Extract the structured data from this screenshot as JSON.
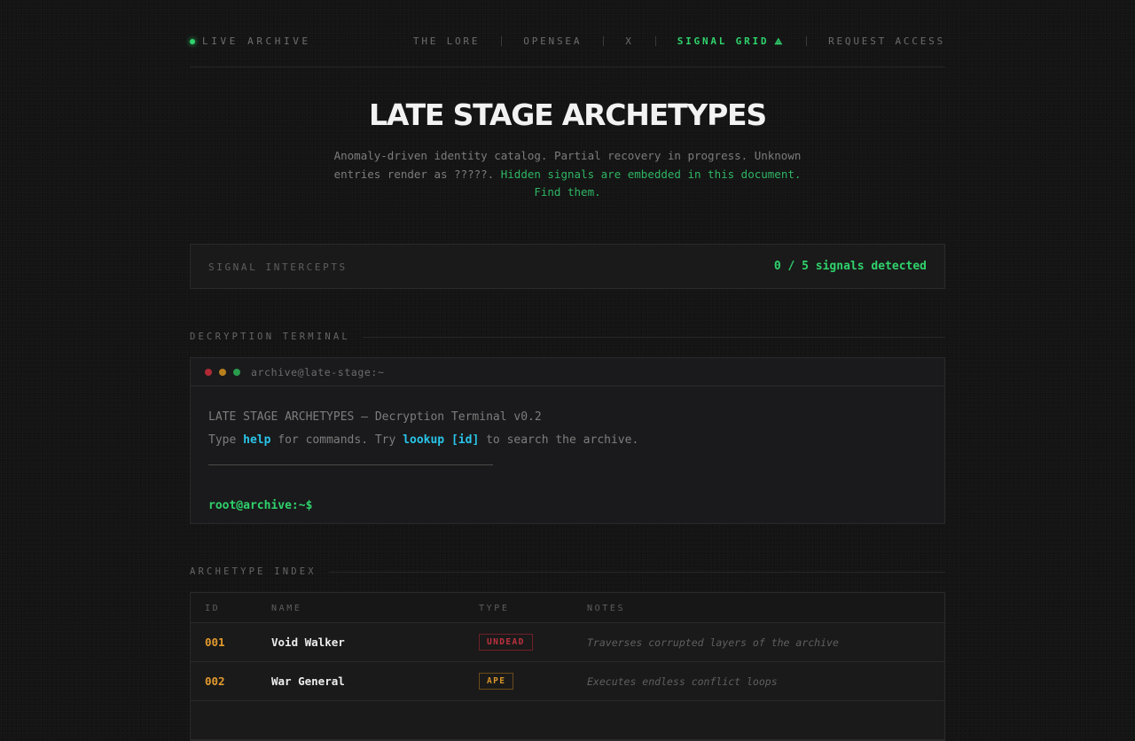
{
  "nav": {
    "live_label": "LIVE ARCHIVE",
    "links": [
      {
        "label": "THE LORE"
      },
      {
        "label": "OPENSEA"
      },
      {
        "label": "X"
      },
      {
        "label": "SIGNAL GRID",
        "icon": "triangle-alert-icon",
        "active": true
      },
      {
        "label": "REQUEST ACCESS"
      }
    ],
    "signal_icon": "⟁"
  },
  "hero": {
    "title": "LATE STAGE ARCHETYPES",
    "subtitle_plain": "Anomaly-driven identity catalog. Partial recovery in progress. Unknown entries render as ?????. ",
    "subtitle_highlight": "Hidden signals are embedded in this document. Find them."
  },
  "intercepts": {
    "label": "SIGNAL INTERCEPTS",
    "count_text": "0 / 5 signals detected"
  },
  "terminal_section": {
    "label": "DECRYPTION TERMINAL"
  },
  "terminal": {
    "title": "archive@late-stage:~",
    "header_line": "LATE STAGE ARCHETYPES — Decryption Terminal v0.2",
    "help_pre": "Type ",
    "help_cmd": "help",
    "help_mid": " for commands. Try ",
    "lookup_cmd": "lookup [id]",
    "help_post": " to search the archive.",
    "prompt": "root@archive:~$"
  },
  "index_section": {
    "label": "ARCHETYPE INDEX"
  },
  "table": {
    "headers": {
      "id": "ID",
      "name": "NAME",
      "type": "TYPE",
      "notes": "NOTES"
    },
    "rows": [
      {
        "id": "001",
        "name": "Void Walker",
        "type": "UNDEAD",
        "type_color": "#c0323f",
        "notes": "Traverses corrupted layers of the archive"
      },
      {
        "id": "002",
        "name": "War General",
        "type": "APE",
        "type_color": "#d8952a",
        "notes": "Executes endless conflict loops"
      }
    ]
  },
  "colors": {
    "accent_green": "#2fd36c",
    "accent_cyan": "#29c4e8",
    "id_orange": "#e39a2d",
    "undead_red": "#c0323f",
    "ape_orange": "#d8952a"
  }
}
